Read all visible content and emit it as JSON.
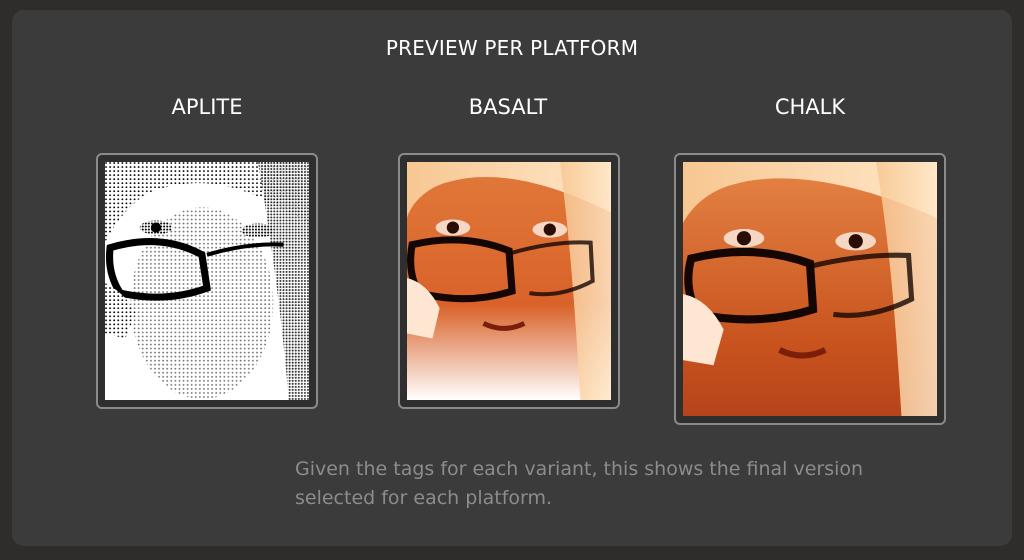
{
  "header": {
    "title": "PREVIEW PER PLATFORM"
  },
  "platforms": [
    {
      "label": "APLITE",
      "style": "dithered-bw"
    },
    {
      "label": "BASALT",
      "style": "color-orange"
    },
    {
      "label": "CHALK",
      "style": "color-orange-round"
    }
  ],
  "caption": {
    "line1": "Given the tags for each variant, this shows the final version",
    "line2": "selected for each platform."
  },
  "colors": {
    "background": "#2f2c2c",
    "panel": "#3b3b3b",
    "frame_border": "#8a8a8a",
    "caption": "#8c8c8c",
    "accent_orange": "#e07a3a"
  }
}
